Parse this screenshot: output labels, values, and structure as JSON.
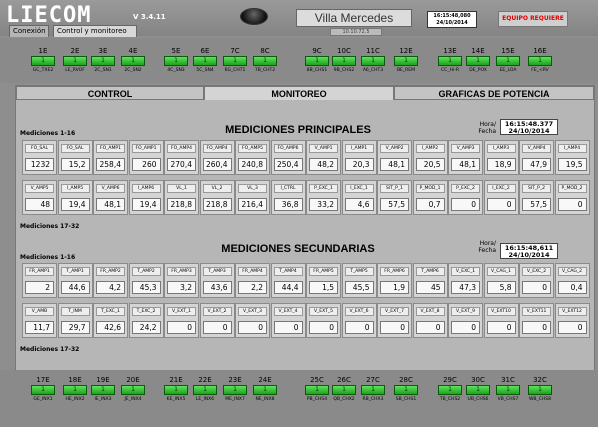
{
  "header": {
    "logo": "LIECOM",
    "version": "V 3.4.11",
    "site": "Villa Mercedes",
    "ip": "10.10.72.5",
    "clock_time": "16:15:48,080",
    "clock_date": "24/10/2014",
    "alarm": "EQUIPO REQUIERE"
  },
  "nav_tabs": [
    "Conexión",
    "Control y monitoreo"
  ],
  "top_io": [
    {
      "n": "1E",
      "v": "1",
      "l": "GC_TXE2"
    },
    {
      "n": "2E",
      "v": "1",
      "l": "LE_RVOF"
    },
    {
      "n": "3E",
      "v": "1",
      "l": "2C_SN1"
    },
    {
      "n": "4E",
      "v": "1",
      "l": "2C_SN2"
    },
    {
      "n": "5E",
      "v": "1",
      "l": "4C_SN3"
    },
    {
      "n": "6E",
      "v": "1",
      "l": "5C_SN4"
    },
    {
      "n": "7C",
      "v": "1",
      "l": "6G_CHT1"
    },
    {
      "n": "8C",
      "v": "1",
      "l": "7B_CHT2"
    },
    {
      "n": "9C",
      "v": "1",
      "l": "8B_CHS1"
    },
    {
      "n": "10C",
      "v": "1",
      "l": "9B_CHS2"
    },
    {
      "n": "11C",
      "v": "1",
      "l": "A6_CHT3"
    },
    {
      "n": "12E",
      "v": "1",
      "l": "BE_REM"
    },
    {
      "n": "13E",
      "v": "1",
      "l": "CC_Hi-R"
    },
    {
      "n": "14E",
      "v": "1",
      "l": "DE_POX"
    },
    {
      "n": "15E",
      "v": "1",
      "l": "EE_LOA"
    },
    {
      "n": "16E",
      "v": "1",
      "l": "FE_<RV"
    }
  ],
  "main_tabs": [
    "CONTROL",
    "MONITOREO",
    "GRAFICAS DE POTENCIA"
  ],
  "principales": {
    "title": "MEDICIONES PRINCIPALES",
    "sub1": "Mediciones 1-16",
    "sub2": "Mediciones 17-32",
    "hora": "Hora/",
    "fecha": "Fecha",
    "time": "16:15:48.377",
    "date": "24/10/2014",
    "row1": [
      {
        "l": "FO_SAL",
        "v": "1232"
      },
      {
        "l": "FO_SAL",
        "v": "15,2"
      },
      {
        "l": "FO_AMP1",
        "v": "258,4"
      },
      {
        "l": "FO_AMP1",
        "v": "260"
      },
      {
        "l": "FO_AMP4",
        "v": "270,4"
      },
      {
        "l": "FO_AMP4",
        "v": "260,4"
      },
      {
        "l": "FO_AMP5",
        "v": "240,8"
      },
      {
        "l": "FO_AMP6",
        "v": "250,4"
      },
      {
        "l": "V_AMP1",
        "v": "48,2"
      },
      {
        "l": "I_AMP1",
        "v": "20,3"
      },
      {
        "l": "V_AMP2",
        "v": "48,1"
      },
      {
        "l": "I_AMP2",
        "v": "20,5"
      },
      {
        "l": "V_AMP3",
        "v": "48,1"
      },
      {
        "l": "I_AMP3",
        "v": "18,9"
      },
      {
        "l": "V_AMP4",
        "v": "47,9"
      },
      {
        "l": "I_AMP4",
        "v": "19,5"
      }
    ],
    "row2": [
      {
        "l": "V_AMP5",
        "v": "48"
      },
      {
        "l": "I_AMP5",
        "v": "19,4"
      },
      {
        "l": "V_AMP6",
        "v": "48,1"
      },
      {
        "l": "I_AMP6",
        "v": "19,4"
      },
      {
        "l": "VL_1",
        "v": "218,8"
      },
      {
        "l": "VL_2",
        "v": "218,8"
      },
      {
        "l": "VL_3",
        "v": "216,4"
      },
      {
        "l": "I_CTRL",
        "v": "36,8"
      },
      {
        "l": "P_EXC_1",
        "v": "33,2"
      },
      {
        "l": "I_EXC_1",
        "v": "4,6"
      },
      {
        "l": "SIT_P_1",
        "v": "57,5"
      },
      {
        "l": "P_MOD_1",
        "v": "0,7"
      },
      {
        "l": "P_EXC_2",
        "v": "0"
      },
      {
        "l": "I_EXC_2",
        "v": "0"
      },
      {
        "l": "SIT_P_2",
        "v": "57,5"
      },
      {
        "l": "P_MOD_2",
        "v": "0"
      }
    ]
  },
  "secundarias": {
    "title": "MEDICIONES SECUNDARIAS",
    "sub1": "Mediciones 1-16",
    "sub2": "Mediciones  17-32",
    "hora": "Hora/",
    "fecha": "Fecha",
    "time": "16:15:48,611",
    "date": "24/10/2014",
    "row1": [
      {
        "l": "FR_AMP1",
        "v": "2"
      },
      {
        "l": "T_AMP1",
        "v": "44,6"
      },
      {
        "l": "FR_AMP2",
        "v": "4,2"
      },
      {
        "l": "T_AMP2",
        "v": "45,3"
      },
      {
        "l": "FR_AMP3",
        "v": "3,2"
      },
      {
        "l": "T_AMP3",
        "v": "43,6"
      },
      {
        "l": "FR_AMP4",
        "v": "2,2"
      },
      {
        "l": "T_AMP4",
        "v": "44,4"
      },
      {
        "l": "FR_AMP5",
        "v": "1,5"
      },
      {
        "l": "T_AMP5",
        "v": "45,5"
      },
      {
        "l": "FR_AMP6",
        "v": "1,9"
      },
      {
        "l": "T_AMP6",
        "v": "45"
      },
      {
        "l": "V_EXC_1",
        "v": "47,3"
      },
      {
        "l": "V_CAG_1",
        "v": "5,8"
      },
      {
        "l": "V_EXC_2",
        "v": "0"
      },
      {
        "l": "V_CAG_2",
        "v": "0,4"
      }
    ],
    "row2": [
      {
        "l": "V_AMB",
        "v": "11,7"
      },
      {
        "l": "T_INM",
        "v": "29,7"
      },
      {
        "l": "T_EXC_1",
        "v": "42,6"
      },
      {
        "l": "T_EXC_2",
        "v": "24,2"
      },
      {
        "l": "V_EXT_1",
        "v": "0"
      },
      {
        "l": "V_EXT_2",
        "v": "0"
      },
      {
        "l": "V_EXT_3",
        "v": "0"
      },
      {
        "l": "V_EXT_4",
        "v": "0"
      },
      {
        "l": "V_EXT_5",
        "v": "0"
      },
      {
        "l": "V_EXT_6",
        "v": "0"
      },
      {
        "l": "V_EXT_7",
        "v": "0"
      },
      {
        "l": "V_EXT_8",
        "v": "0"
      },
      {
        "l": "V_EXT_9",
        "v": "0"
      },
      {
        "l": "V_EXT10",
        "v": "0"
      },
      {
        "l": "V_EXT11",
        "v": "0"
      },
      {
        "l": "V_EXT12",
        "v": "0"
      }
    ]
  },
  "bottom_io": [
    {
      "n": "17E",
      "v": "1",
      "l": "GE_INX1"
    },
    {
      "n": "18E",
      "v": "1",
      "l": "HE_INX2"
    },
    {
      "n": "19E",
      "v": "1",
      "l": "IE_INX3"
    },
    {
      "n": "20E",
      "v": "1",
      "l": "JE_INX4"
    },
    {
      "n": "21E",
      "v": "1",
      "l": "KE_INX5"
    },
    {
      "n": "22E",
      "v": "1",
      "l": "LE_INX6"
    },
    {
      "n": "23E",
      "v": "1",
      "l": "ME_INX7"
    },
    {
      "n": "24E",
      "v": "1",
      "l": "NE_INX8"
    },
    {
      "n": "25C",
      "v": "1",
      "l": "PB_CHS4"
    },
    {
      "n": "26C",
      "v": "1",
      "l": "QB_CHX2"
    },
    {
      "n": "27C",
      "v": "1",
      "l": "RB_CHX3"
    },
    {
      "n": "28C",
      "v": "1",
      "l": "SB_CHS1"
    },
    {
      "n": "29C",
      "v": "1",
      "l": "TB_CHS2"
    },
    {
      "n": "30C",
      "v": "1",
      "l": "UB_CHS6"
    },
    {
      "n": "31C",
      "v": "1",
      "l": "VB_CHS7"
    },
    {
      "n": "32C",
      "v": "1",
      "l": "WB_CHS8"
    }
  ]
}
